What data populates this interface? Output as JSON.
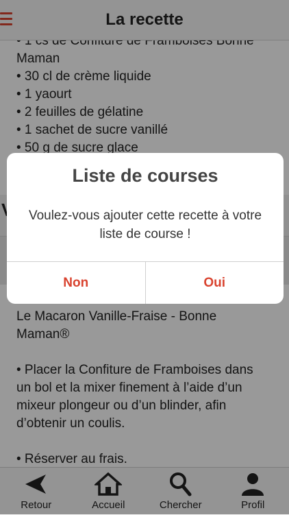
{
  "header": {
    "title": "La recette"
  },
  "ingredients": [
    "• 1 cs de Confiture de Framboises Bonne",
    "Maman",
    "• 30 cl de crème liquide",
    "• 1 yaourt",
    "• 2 feuilles de gélatine",
    "• 1 sachet de sucre vanillé",
    "• 50 g de sucre glace"
  ],
  "section_letter": "V",
  "description": {
    "title_line1": "Le Macaron Vanille-Fraise - Bonne",
    "title_line2": "Maman®",
    "step1_line1": "• Placer la Confiture de Framboises dans",
    "step1_line2": "un bol et la mixer finement à l’aide d’un",
    "step1_line3": "mixeur plongeur ou d’un blinder, afin",
    "step1_line4": "d’obtenir un coulis.",
    "step2": "• Réserver au frais."
  },
  "dialog": {
    "title": "Liste de courses",
    "message_line1": "Voulez-vous ajouter cette recette à votre",
    "message_line2": "liste de course !",
    "no_label": "Non",
    "yes_label": "Oui"
  },
  "tabbar": {
    "items": [
      {
        "label": "Retour",
        "icon": "back-arrow-icon"
      },
      {
        "label": "Accueil",
        "icon": "home-icon"
      },
      {
        "label": "Chercher",
        "icon": "search-icon"
      },
      {
        "label": "Profil",
        "icon": "user-icon"
      }
    ]
  },
  "colors": {
    "accent": "#d9432f",
    "overlay": "rgba(0,0,0,0.40)"
  }
}
